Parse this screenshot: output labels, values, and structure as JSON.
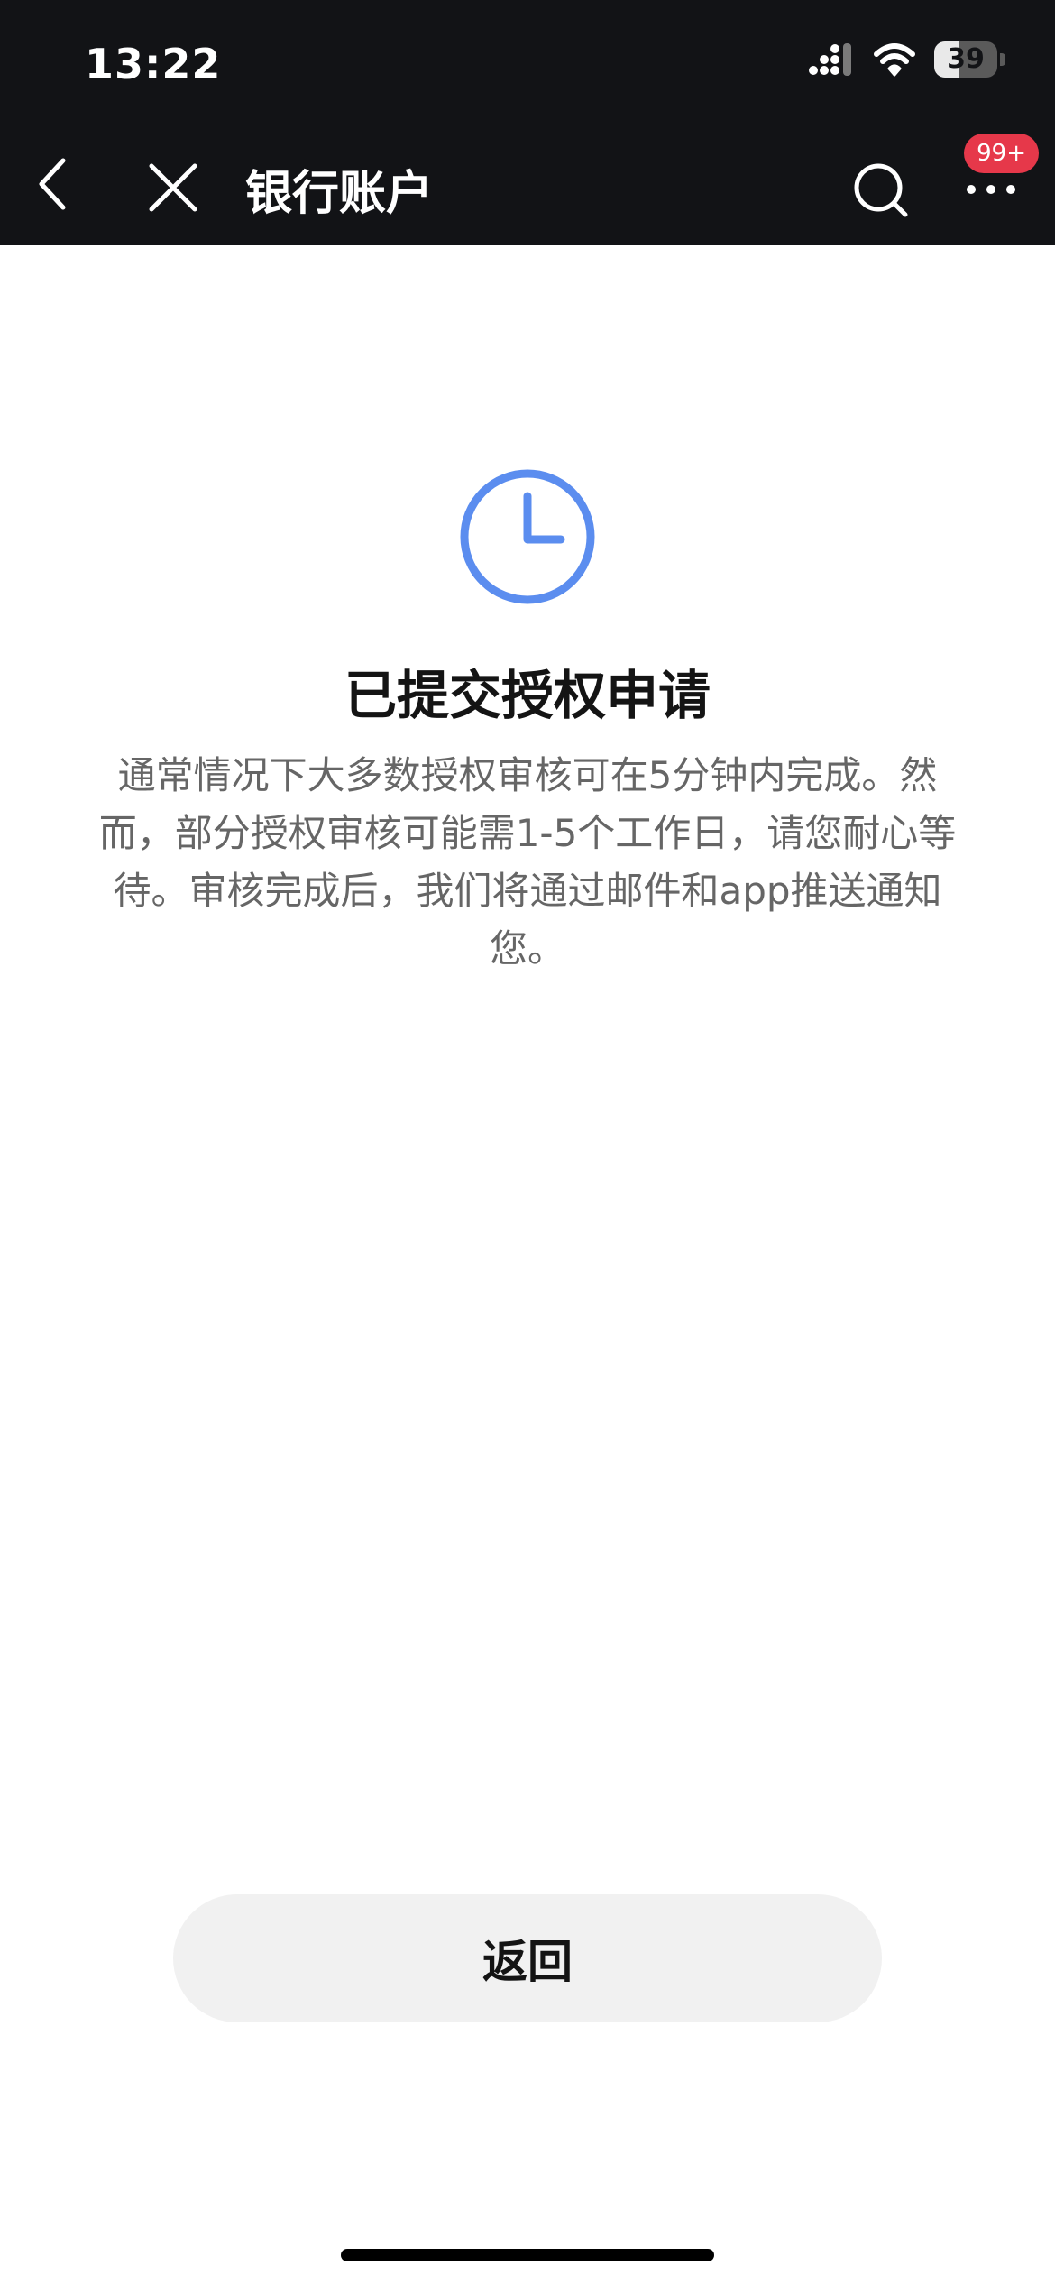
{
  "status_bar": {
    "time": "13:22",
    "battery_level": "39",
    "battery_fraction": 0.39
  },
  "nav": {
    "title": "银行账户",
    "badge": "99+",
    "icons": [
      "back-icon",
      "close-icon",
      "search-icon",
      "more-icon"
    ]
  },
  "main": {
    "icon": "clock-icon",
    "accent_color": "#5b8def",
    "title": "已提交授权申请",
    "description": "通常情况下大多数授权审核可在5分钟内完成。然而，部分授权审核可能需1-5个工作日，请您耐心等待。审核完成后，我们将通过邮件和app推送通知您。"
  },
  "footer": {
    "return_label": "返回"
  },
  "colors": {
    "nav_background": "#121316",
    "badge": "#e6384a",
    "button_background": "#f1f1f1"
  }
}
